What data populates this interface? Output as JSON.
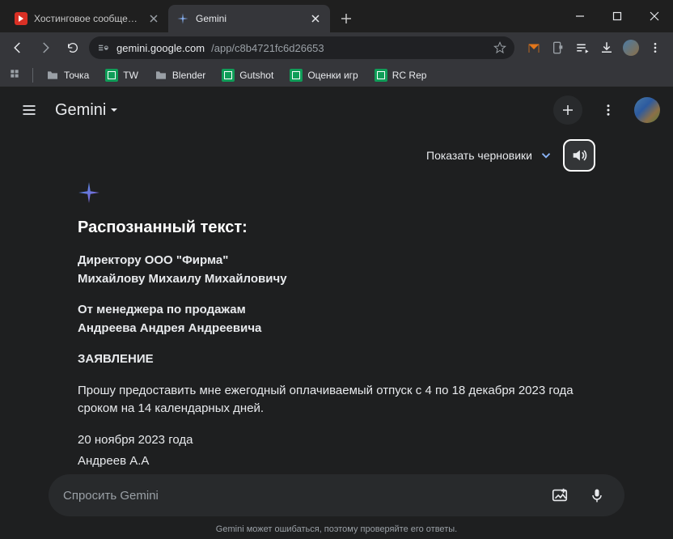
{
  "window": {
    "tabs": [
      {
        "title": "Хостинговое сообщество «Tim",
        "active": false
      },
      {
        "title": "Gemini",
        "active": true
      }
    ]
  },
  "toolbar": {
    "url_host": "gemini.google.com",
    "url_path": "/app/c8b4721fc6d26653"
  },
  "bookmarks": {
    "items": [
      {
        "label": "Точка",
        "type": "folder"
      },
      {
        "label": "TW",
        "type": "sheets"
      },
      {
        "label": "Blender",
        "type": "folder"
      },
      {
        "label": "Gutshot",
        "type": "sheets"
      },
      {
        "label": "Оценки игр",
        "type": "sheets"
      },
      {
        "label": "RC Rep",
        "type": "sheets"
      }
    ]
  },
  "app": {
    "brand": "Gemini",
    "drafts_label": "Показать черновики",
    "input_placeholder": "Спросить Gemini",
    "disclaimer": "Gemini может ошибаться, поэтому проверяйте его ответы."
  },
  "response": {
    "heading": "Распознанный текст:",
    "line1a": "Директору ООО \"Фирма\"",
    "line1b": "Михайлову Михаилу Михайловичу",
    "line2a": "От менеджера по продажам",
    "line2b": "Андреева Андрея Андреевича",
    "statement": "ЗАЯВЛЕНИЕ",
    "body": "Прошу предоставить мне ежегодный оплачиваемый отпуск с 4 по 18 декабря 2023 года сроком на 14 календарных дней.",
    "date": "20 ноября 2023 года",
    "sign": "Андреев А.А"
  }
}
